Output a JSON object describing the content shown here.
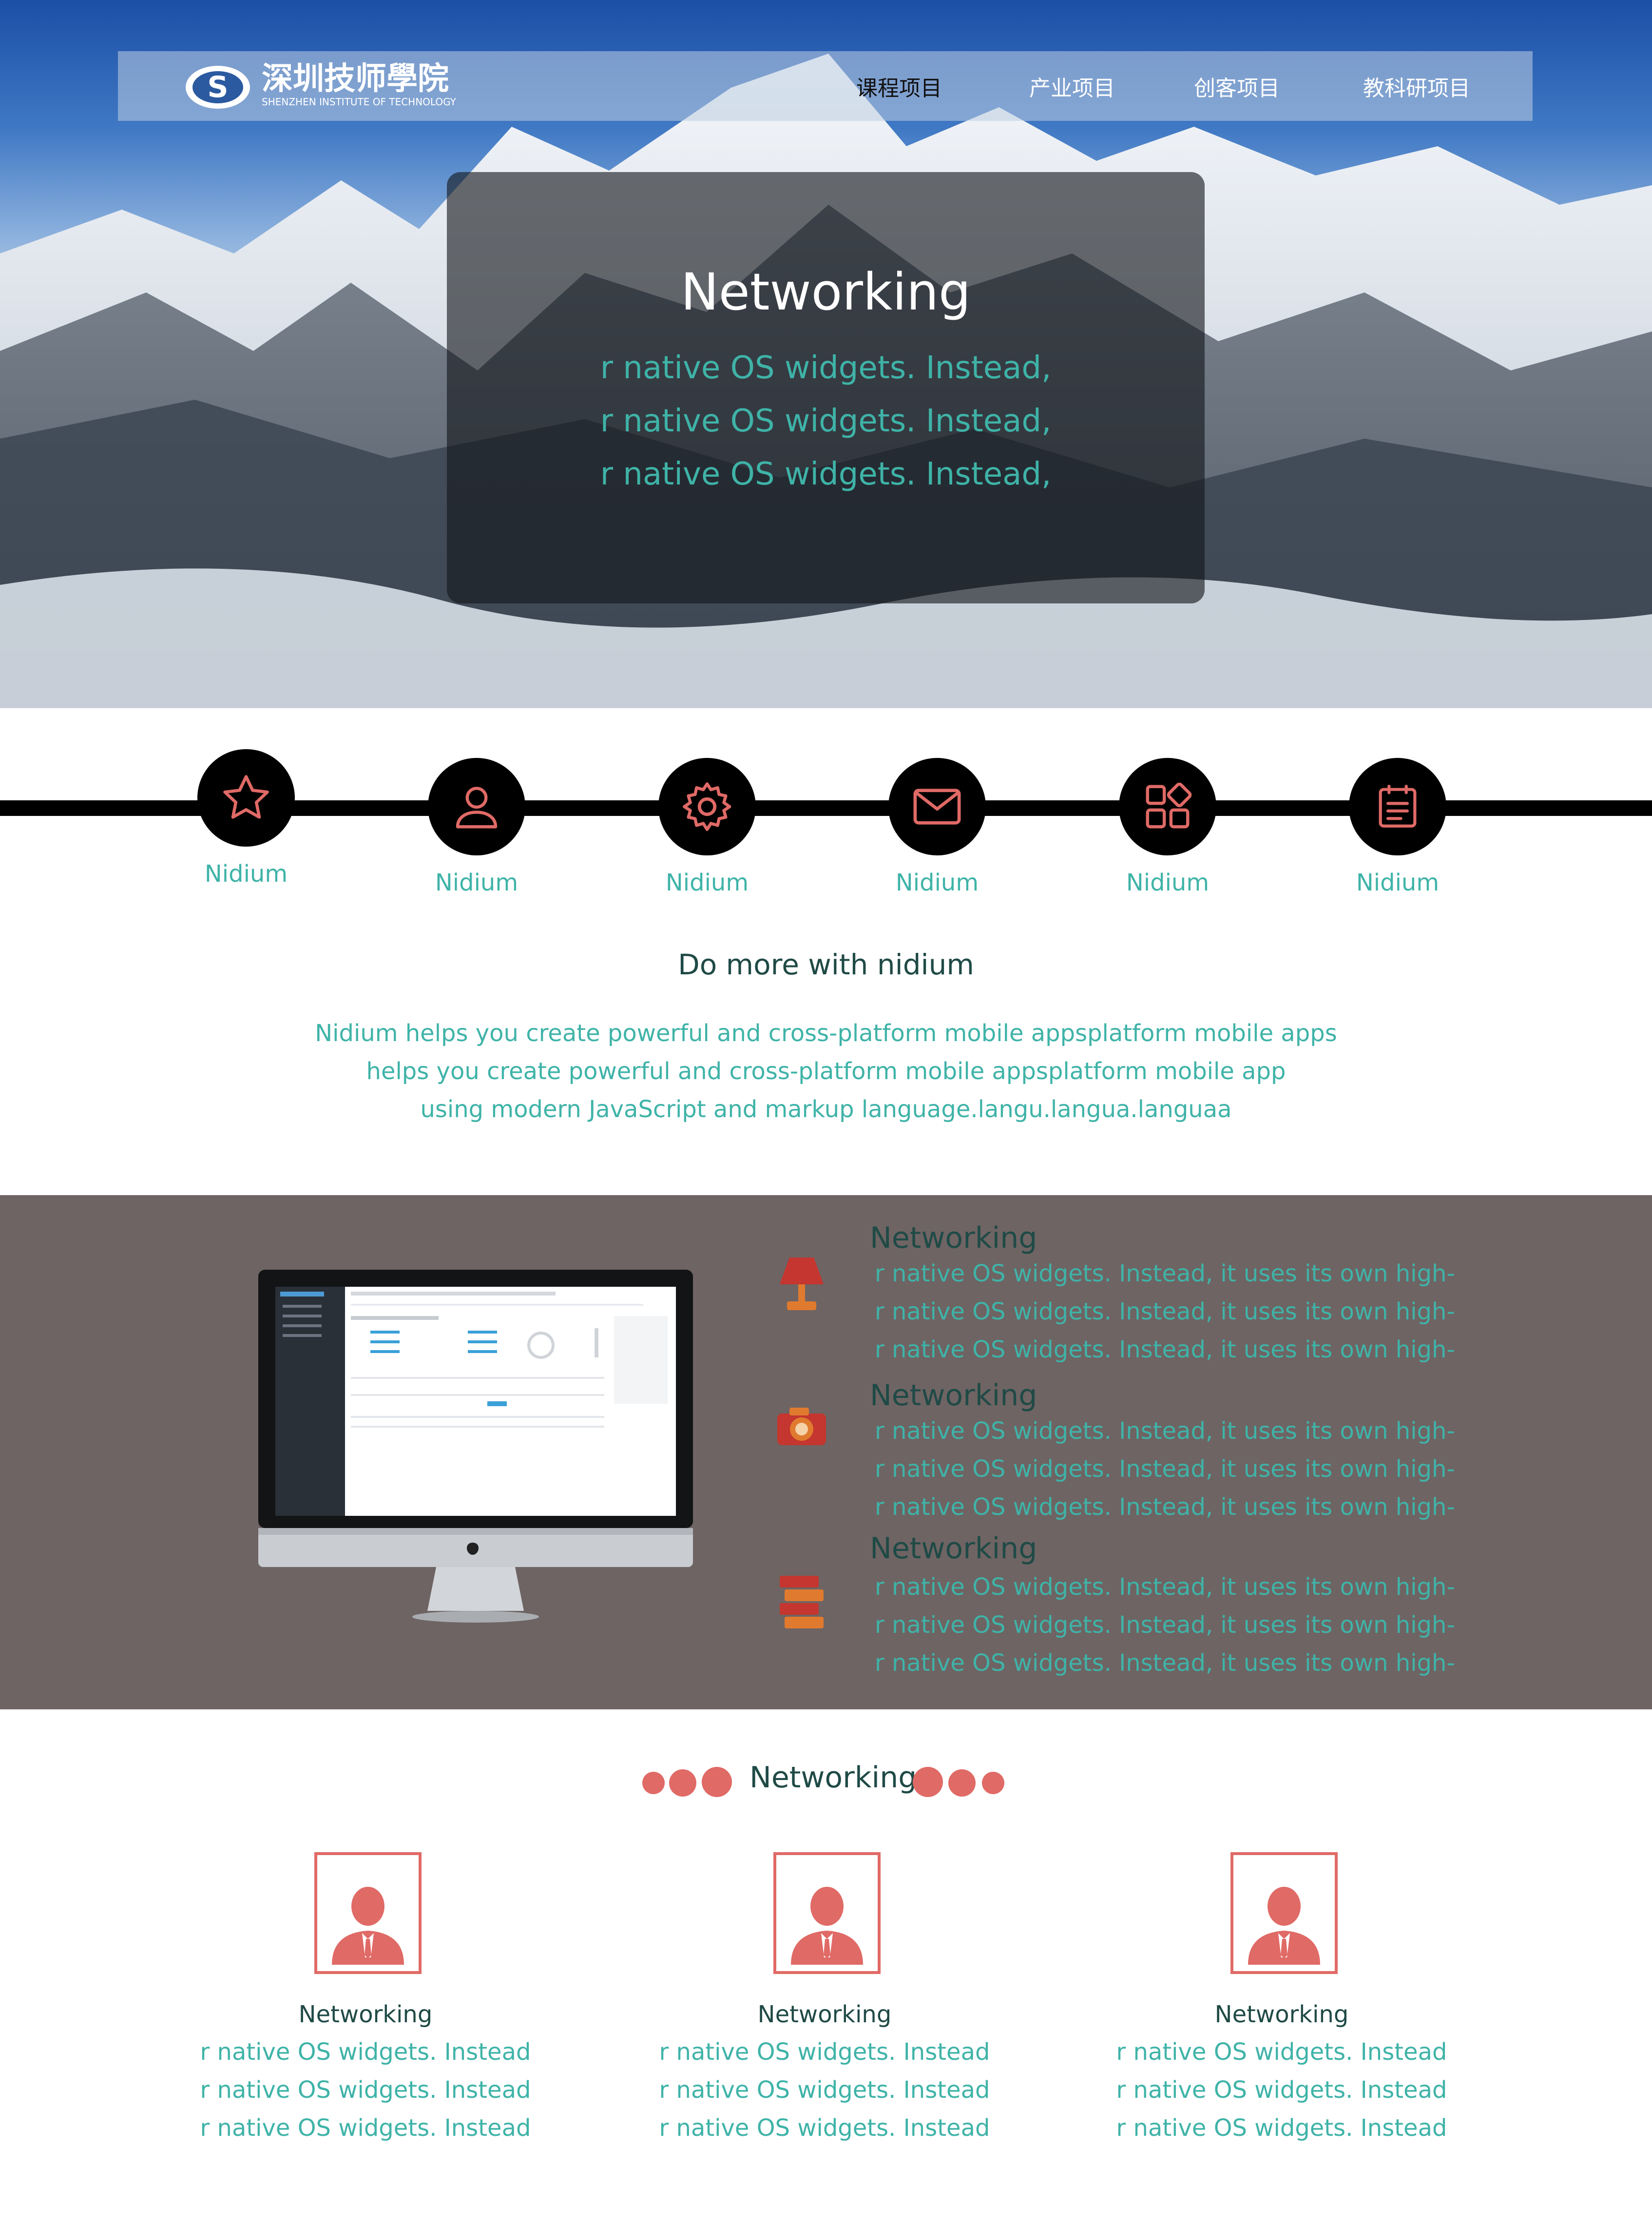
{
  "header": {
    "logo_cn": "深圳技师學院",
    "logo_en": "SHENZHEN INSTITUTE OF TECHNOLOGY",
    "nav": [
      {
        "label": "课程项目",
        "active": true
      },
      {
        "label": "产业项目",
        "active": false
      },
      {
        "label": "创客项目",
        "active": false
      },
      {
        "label": "教科研项目",
        "active": false
      }
    ]
  },
  "hero": {
    "title": "Networking",
    "lines": [
      "r native OS widgets. Instead,",
      "r native OS widgets. Instead,",
      "r native OS widgets. Instead,"
    ]
  },
  "features": [
    {
      "icon": "star-icon",
      "label": "Nidium"
    },
    {
      "icon": "user-icon",
      "label": "Nidium"
    },
    {
      "icon": "gear-icon",
      "label": "Nidium"
    },
    {
      "icon": "mail-icon",
      "label": "Nidium"
    },
    {
      "icon": "apps-icon",
      "label": "Nidium"
    },
    {
      "icon": "notepad-icon",
      "label": "Nidium"
    }
  ],
  "intro": {
    "tagline": "Do more with nidium",
    "lines": [
      "Nidium helps you create powerful and cross-platform mobile appsplatform mobile apps",
      "helps you create powerful and cross-platform mobile appsplatform mobile app",
      "using modern JavaScript and markup language.langu.langua.languaa"
    ]
  },
  "showcase": {
    "blocks": [
      {
        "icon": "lamp-icon",
        "title": "Networking",
        "lines": [
          "r native OS widgets. Instead, it uses its own high-",
          "r native OS widgets. Instead, it uses its own high-",
          "r native OS widgets. Instead, it uses its own high-"
        ]
      },
      {
        "icon": "camera-icon",
        "title": "Networking",
        "lines": [
          "r native OS widgets. Instead, it uses its own high-",
          "r native OS widgets. Instead, it uses its own high-",
          "r native OS widgets. Instead, it uses its own high-"
        ]
      },
      {
        "icon": "books-icon",
        "title": "Networking",
        "lines": [
          "r native OS widgets. Instead, it uses its own high-",
          "r native OS widgets. Instead, it uses its own high-",
          "r native OS widgets. Instead, it uses its own high-"
        ]
      }
    ]
  },
  "team": {
    "title": "Networking",
    "members": [
      {
        "name": "Networking",
        "lines": [
          "r native OS widgets. Instead",
          "r native OS widgets. Instead",
          "r native OS widgets. Instead"
        ]
      },
      {
        "name": "Networking",
        "lines": [
          "r native OS widgets. Instead",
          "r native OS widgets. Instead",
          "r native OS widgets. Instead"
        ]
      },
      {
        "name": "Networking",
        "lines": [
          "r native OS widgets. Instead",
          "r native OS widgets. Instead",
          "r native OS widgets. Instead"
        ]
      }
    ]
  },
  "colors": {
    "accent_teal": "#3fb3a8",
    "accent_coral": "#e06a66",
    "heading_dark_green": "#1f4a46",
    "section_gray": "#6e6463"
  }
}
